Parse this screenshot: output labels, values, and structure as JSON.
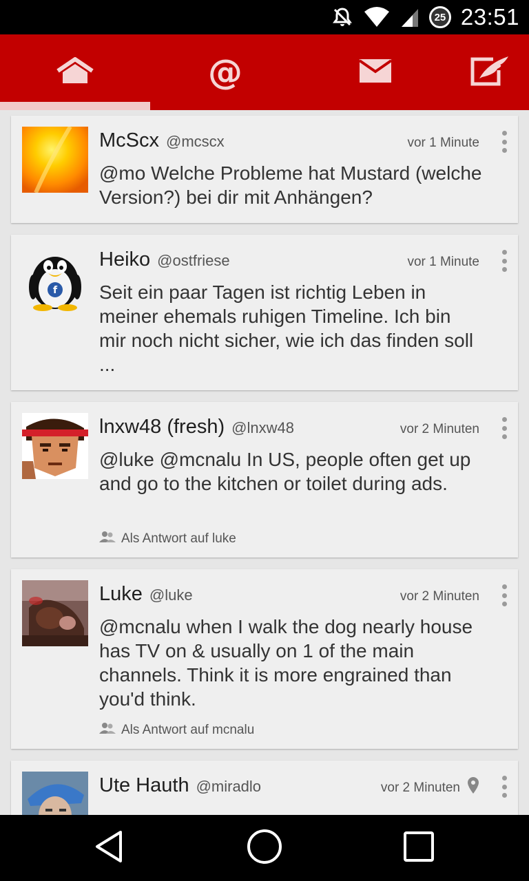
{
  "status_bar": {
    "time": "23:51",
    "battery_level": "25",
    "icons": [
      "notifications-off-icon",
      "wifi-icon",
      "cell-signal-icon",
      "battery-icon"
    ]
  },
  "toolbar": {
    "accent_color": "#c20000",
    "tabs": [
      {
        "icon": "home-icon",
        "selected": true
      },
      {
        "icon": "at-mention-icon",
        "glyph": "@",
        "selected": false
      },
      {
        "icon": "envelope-icon",
        "selected": false
      },
      {
        "icon": "compose-icon",
        "selected": false
      }
    ]
  },
  "posts": [
    {
      "name": "McScx",
      "handle": "@mcscx",
      "time": "vor 1 Minute",
      "text": "@mo Welche Probleme hat Mustard (welche Version?) bei dir mit Anhängen?",
      "reply_to": null,
      "location": false
    },
    {
      "name": "Heiko",
      "handle": "@ostfriese",
      "time": "vor 1 Minute",
      "text": "Seit ein paar Tagen ist richtig Leben in meiner ehemals ruhigen Timeline. Ich bin mir noch nicht sicher, wie ich das finden soll ...",
      "reply_to": null,
      "location": false
    },
    {
      "name": "lnxw48 (fresh)",
      "handle": "@lnxw48",
      "time": "vor 2 Minuten",
      "text": "@luke @mcnalu In US, people often get up and go to the kitchen or toilet during ads.",
      "reply_to": "Als Antwort auf luke",
      "location": false
    },
    {
      "name": "Luke",
      "handle": "@luke",
      "time": "vor 2 Minuten",
      "text": "@mcnalu when I walk the dog nearly house has TV on & usually on 1 of the main channels. Think it is more engrained than you'd think.",
      "reply_to": "Als Antwort auf mcnalu",
      "location": false
    },
    {
      "name": "Ute Hauth",
      "handle": "@miradlo",
      "time": "vor 2 Minuten",
      "text": "",
      "reply_to": null,
      "location": true
    }
  ],
  "nav_bar": {
    "buttons": [
      "back-icon",
      "home-circle-icon",
      "recents-icon"
    ]
  }
}
